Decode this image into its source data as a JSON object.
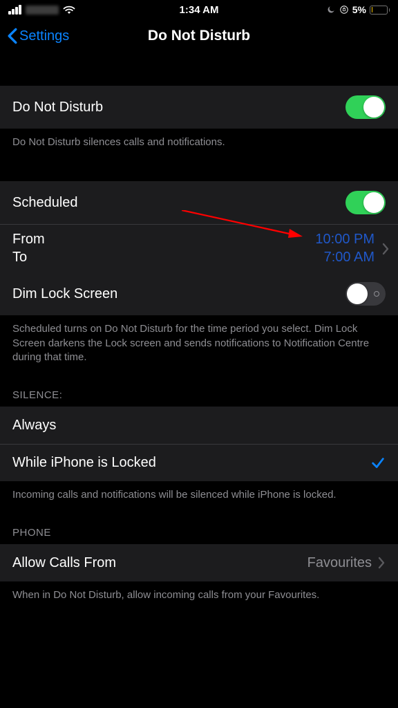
{
  "status_bar": {
    "time": "1:34 AM",
    "battery_percent": "5%"
  },
  "nav": {
    "back_label": "Settings",
    "title": "Do Not Disturb"
  },
  "dnd": {
    "label": "Do Not Disturb",
    "footer": "Do Not Disturb silences calls and notifications."
  },
  "scheduled": {
    "label": "Scheduled",
    "from_label": "From",
    "to_label": "To",
    "from_time": "10:00 PM",
    "to_time": "7:00 AM"
  },
  "dim": {
    "label": "Dim Lock Screen",
    "footer": "Scheduled turns on Do Not Disturb for the time period you select. Dim Lock Screen darkens the Lock screen and sends notifications to Notification Centre during that time."
  },
  "silence": {
    "header": "SILENCE:",
    "always": "Always",
    "while_locked": "While iPhone is Locked",
    "footer": "Incoming calls and notifications will be silenced while iPhone is locked."
  },
  "phone": {
    "header": "PHONE",
    "allow_label": "Allow Calls From",
    "allow_value": "Favourites",
    "footer": "When in Do Not Disturb, allow incoming calls from your Favourites."
  }
}
